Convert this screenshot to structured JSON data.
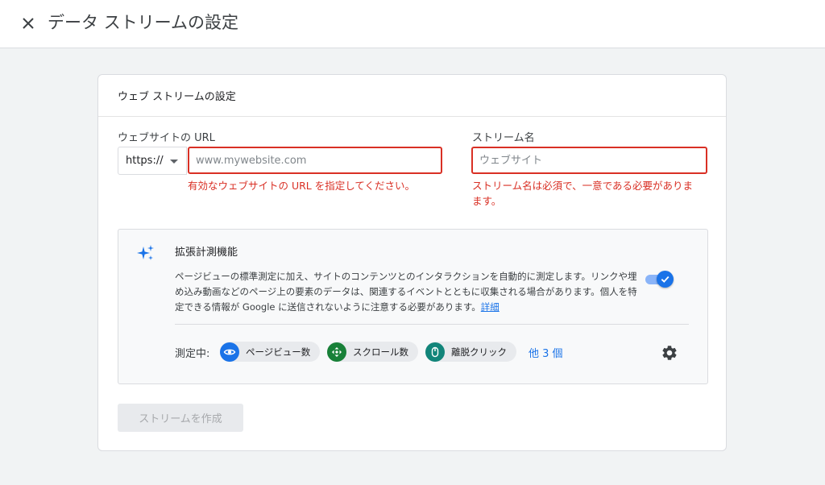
{
  "header": {
    "title": "データ ストリームの設定",
    "close_icon": "close-icon"
  },
  "card": {
    "title": "ウェブ ストリームの設定",
    "website_url": {
      "label": "ウェブサイトの URL",
      "protocol_selected": "https://",
      "placeholder": "www.mywebsite.com",
      "value": "",
      "error": "有効なウェブサイトの URL を指定してください。"
    },
    "stream_name": {
      "label": "ストリーム名",
      "placeholder": "ウェブサイト",
      "value": "",
      "error_line1": "ストリーム名は必須で、一意である必要がありま",
      "error_line2": "ます。"
    },
    "enhanced": {
      "icon": "sparkle-icon",
      "title": "拡張計測機能",
      "description": "ページビューの標準測定に加え、サイトのコンテンツとのインタラクションを自動的に測定します。リンクや埋め込み動画などのページ上の要素のデータは、関連するイベントとともに収集される場合があります。個人を特定できる情報が Google に送信されないように注意する必要があります。",
      "learn_more": "詳細",
      "toggle_on": true,
      "measuring_label": "測定中:",
      "chips": [
        {
          "label": "ページビュー数",
          "icon": "eye-icon",
          "color": "#1a73e8"
        },
        {
          "label": "スクロール数",
          "icon": "scroll-arrows-icon",
          "color": "#188038"
        },
        {
          "label": "離脱クリック",
          "icon": "mouse-icon",
          "color": "#12857a"
        }
      ],
      "more_label": "他 3 個",
      "settings_icon": "gear-icon"
    },
    "create_button": "ストリームを作成"
  },
  "colors": {
    "error": "#d93025",
    "link": "#1a73e8",
    "page_bg": "#f1f3f4"
  }
}
